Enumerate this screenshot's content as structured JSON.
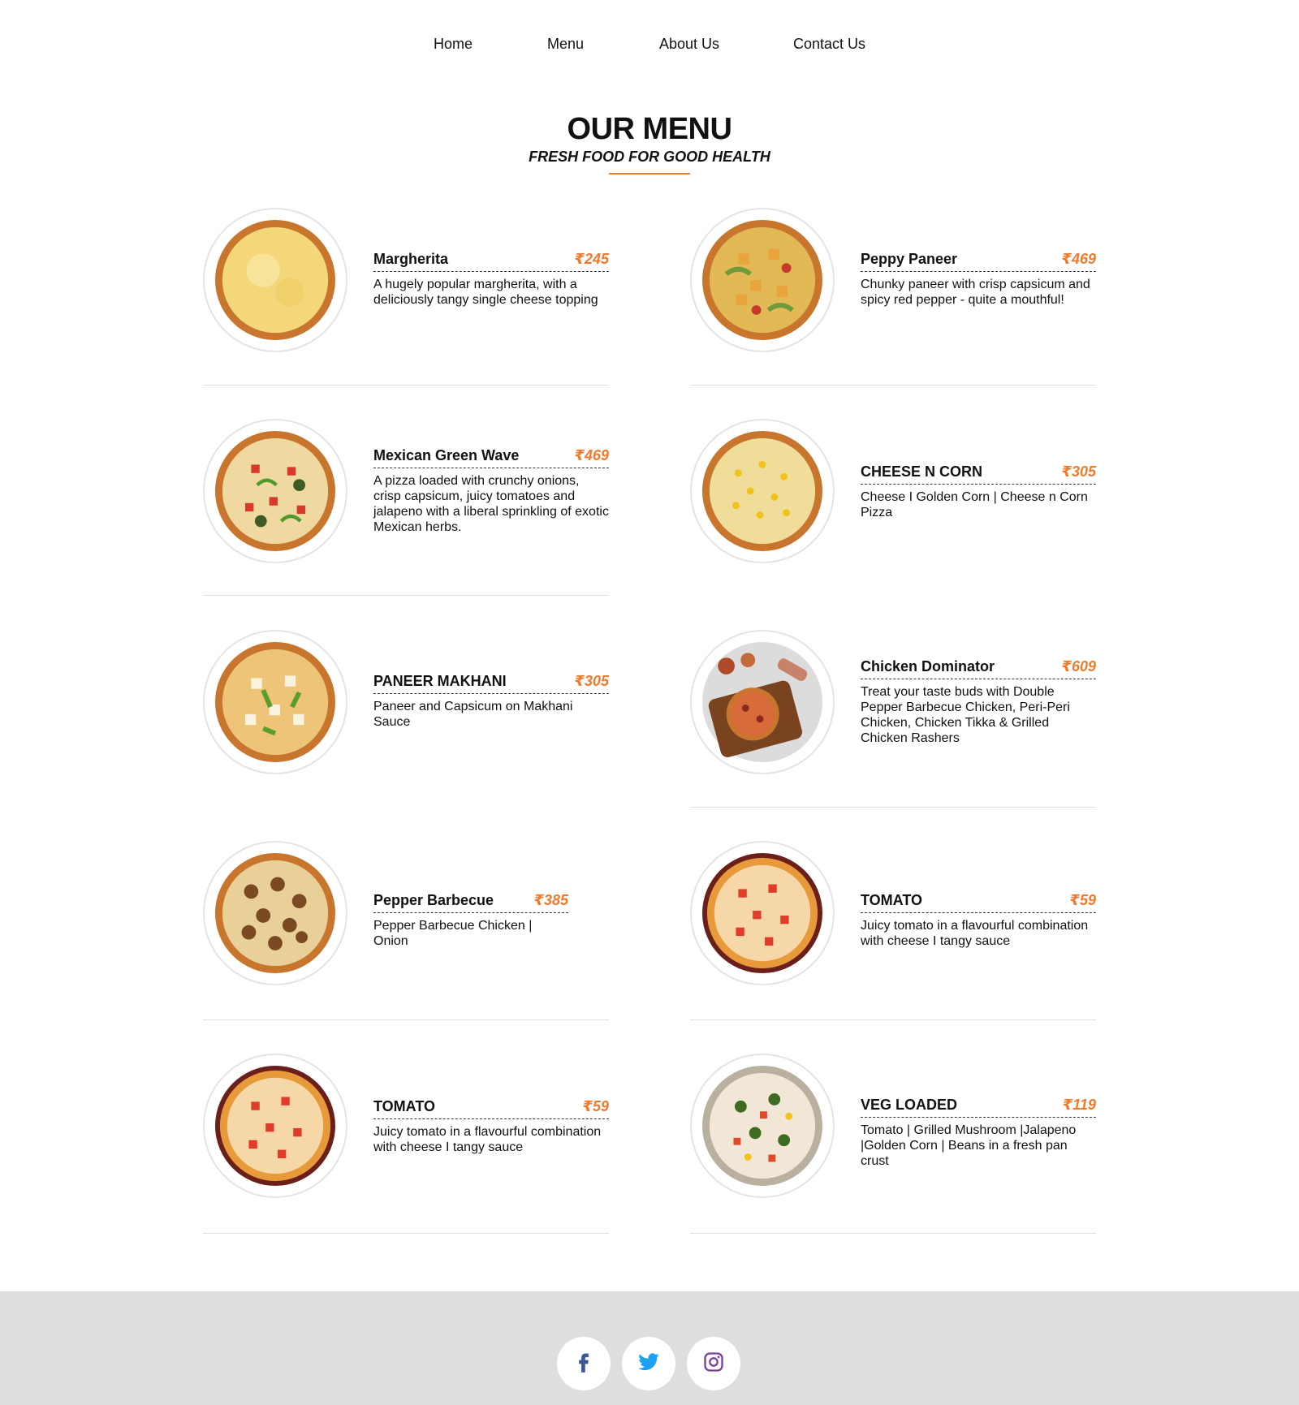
{
  "nav": {
    "home": "Home",
    "menu": "Menu",
    "about": "About Us",
    "contact": "Contact Us"
  },
  "header": {
    "title": "OUR MENU",
    "subtitle": "FRESH FOOD FOR GOOD HEALTH"
  },
  "accent_color": "#f07a2c",
  "menu_items": [
    {
      "name": "Margherita",
      "price": "₹245",
      "desc": "A hugely popular margherita, with a deliciously tangy single cheese topping"
    },
    {
      "name": "Peppy Paneer",
      "price": "₹469",
      "desc": "Chunky paneer with crisp capsicum and spicy red pepper - quite a mouthful!"
    },
    {
      "name": "Mexican Green Wave",
      "price": "₹469",
      "desc": "A pizza loaded with crunchy onions, crisp capsicum, juicy tomatoes and jalapeno with a liberal sprinkling of exotic Mexican herbs."
    },
    {
      "name": "CHEESE N CORN",
      "price": "₹305",
      "desc": "Cheese I Golden Corn | Cheese n Corn Pizza"
    },
    {
      "name": "PANEER MAKHANI",
      "price": "₹305",
      "desc": "Paneer and Capsicum on Makhani Sauce"
    },
    {
      "name": "Chicken Dominator",
      "price": "₹609",
      "desc": "Treat your taste buds with Double Pepper Barbecue Chicken, Peri-Peri Chicken, Chicken Tikka & Grilled Chicken Rashers"
    },
    {
      "name": "Pepper Barbecue",
      "price": "₹385",
      "desc": "Pepper Barbecue Chicken | Onion"
    },
    {
      "name": "TOMATO",
      "price": "₹59",
      "desc": "Juicy tomato in a flavourful combination with cheese I tangy sauce"
    },
    {
      "name": "TOMATO",
      "price": "₹59",
      "desc": "Juicy tomato in a flavourful combination with cheese I tangy sauce"
    },
    {
      "name": "VEG LOADED",
      "price": "₹119",
      "desc": "Tomato | Grilled Mushroom |Jalapeno |Golden Corn | Beans in a fresh pan crust"
    }
  ],
  "footer": {
    "social_icons": [
      "facebook-icon",
      "twitter-icon",
      "instagram-icon"
    ]
  }
}
